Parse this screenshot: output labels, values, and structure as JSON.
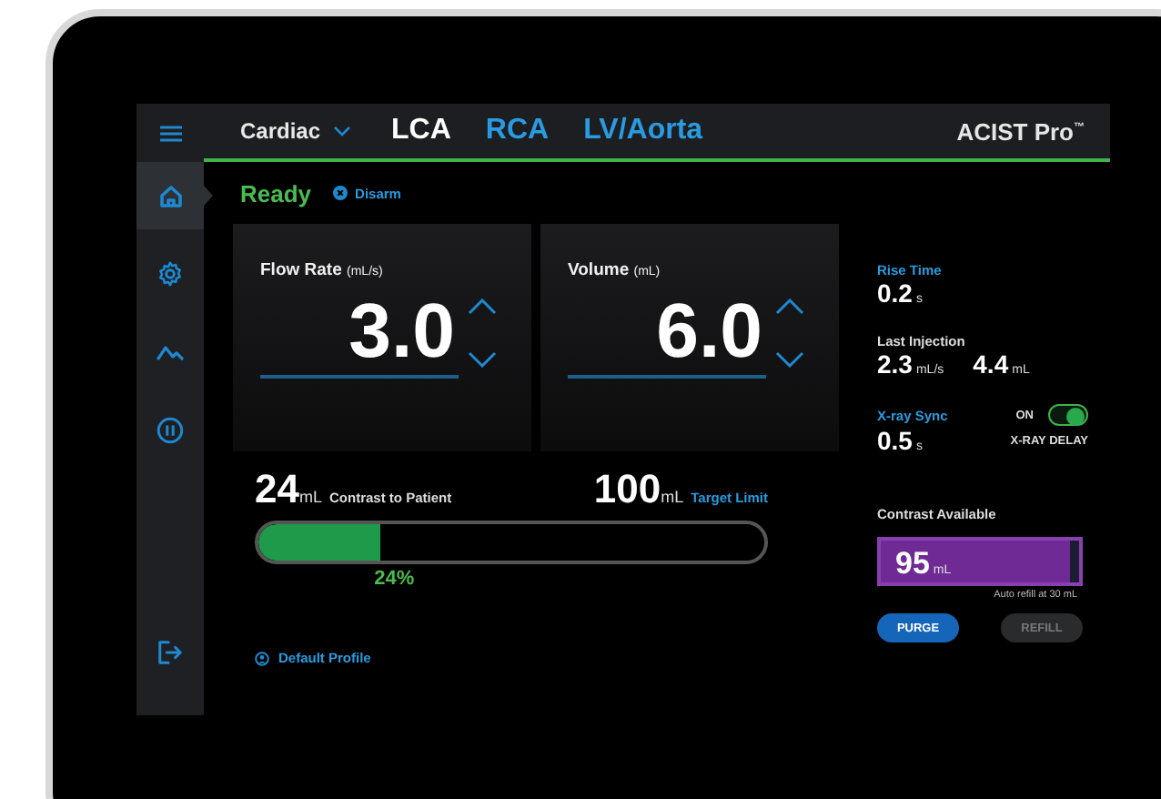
{
  "top_bar": {
    "protocol": "Cardiac",
    "tabs": [
      {
        "label": "LCA",
        "selected": true
      },
      {
        "label": "RCA",
        "selected": false
      },
      {
        "label": "LV/Aorta",
        "selected": false
      }
    ],
    "brand": "ACIST Pro",
    "brand_mark": "™"
  },
  "sidebar": {
    "items": [
      {
        "kind": "home",
        "selected": true
      },
      {
        "kind": "settings",
        "selected": false
      },
      {
        "kind": "chart",
        "selected": false
      },
      {
        "kind": "pause",
        "selected": false
      }
    ],
    "exit": {
      "kind": "exit"
    }
  },
  "status": {
    "text": "Ready",
    "action": "Disarm"
  },
  "parameters": [
    {
      "label": "Flow Rate",
      "unit": "(mL/s)",
      "value": "3.0"
    },
    {
      "label": "Volume",
      "unit": "(mL)",
      "value": "6.0"
    }
  ],
  "contrast_to_patient": {
    "value": "24",
    "unit": "mL",
    "label": "Contrast to Patient",
    "limit_value": "100",
    "limit_unit": "mL",
    "limit_label": "Target Limit",
    "level": 0.24,
    "percent": "24%"
  },
  "profile": "Default Profile",
  "side_panel": {
    "rise_time": {
      "label": "Rise Time",
      "value": "0.2",
      "unit": "s"
    },
    "last_injection": {
      "label": "Last Injection",
      "values": [
        {
          "value": "2.3",
          "unit": "mL/s"
        },
        {
          "value": "4.4",
          "unit": "mL"
        }
      ]
    },
    "xray_sync": {
      "label": "X-ray Sync",
      "value": "0.5",
      "unit": "s",
      "toggle_label": "ON",
      "on": true,
      "caption": "X-RAY DELAY"
    },
    "contrast_available": {
      "label": "Contrast Available",
      "value": "95",
      "unit": "mL",
      "level": 0.95,
      "note": "Auto refill at 30 mL"
    },
    "buttons": [
      {
        "label": "PURGE",
        "disabled": false
      },
      {
        "label": "REFILL",
        "disabled": true
      }
    ]
  }
}
